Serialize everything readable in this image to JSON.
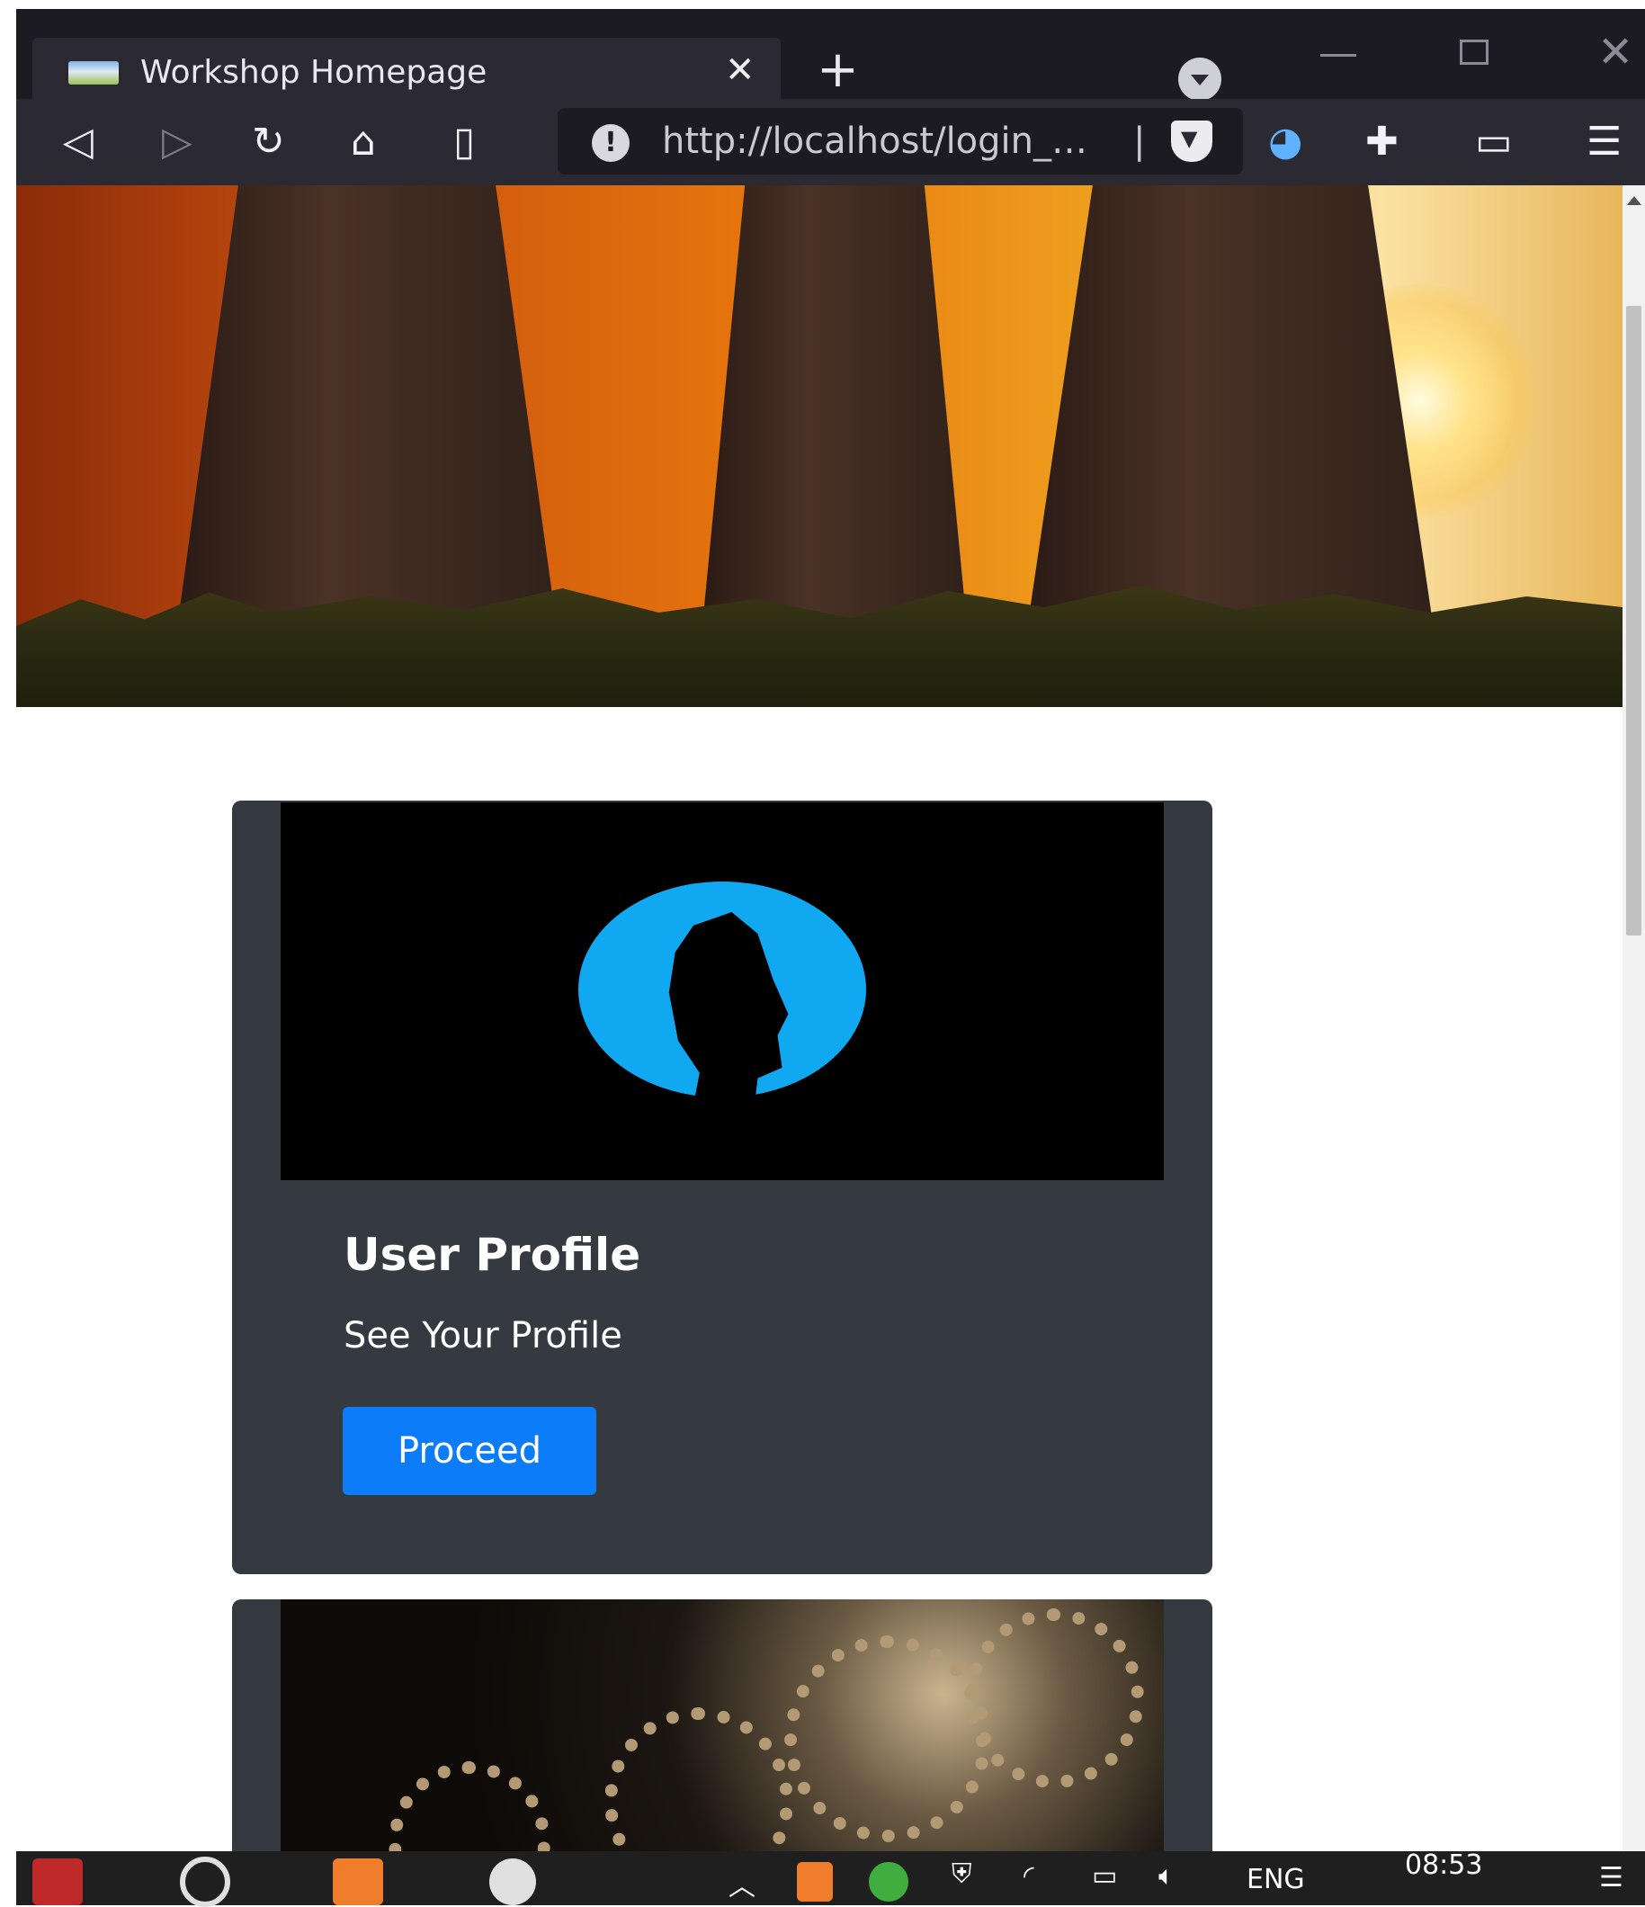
{
  "browser": {
    "tab_title": "Workshop Homepage",
    "tab_close": "✕",
    "new_tab": "+",
    "url": "http://localhost/login_…",
    "url_separator": "|"
  },
  "cards": [
    {
      "title": "User Profile",
      "text": "See Your Profile",
      "button": "Proceed"
    }
  ],
  "taskbar": {
    "language": "ENG",
    "time": "08:53"
  },
  "colors": {
    "button_blue": "#0d7cf8",
    "card_bg": "#343a40",
    "profile_circle": "#10a8f0"
  }
}
